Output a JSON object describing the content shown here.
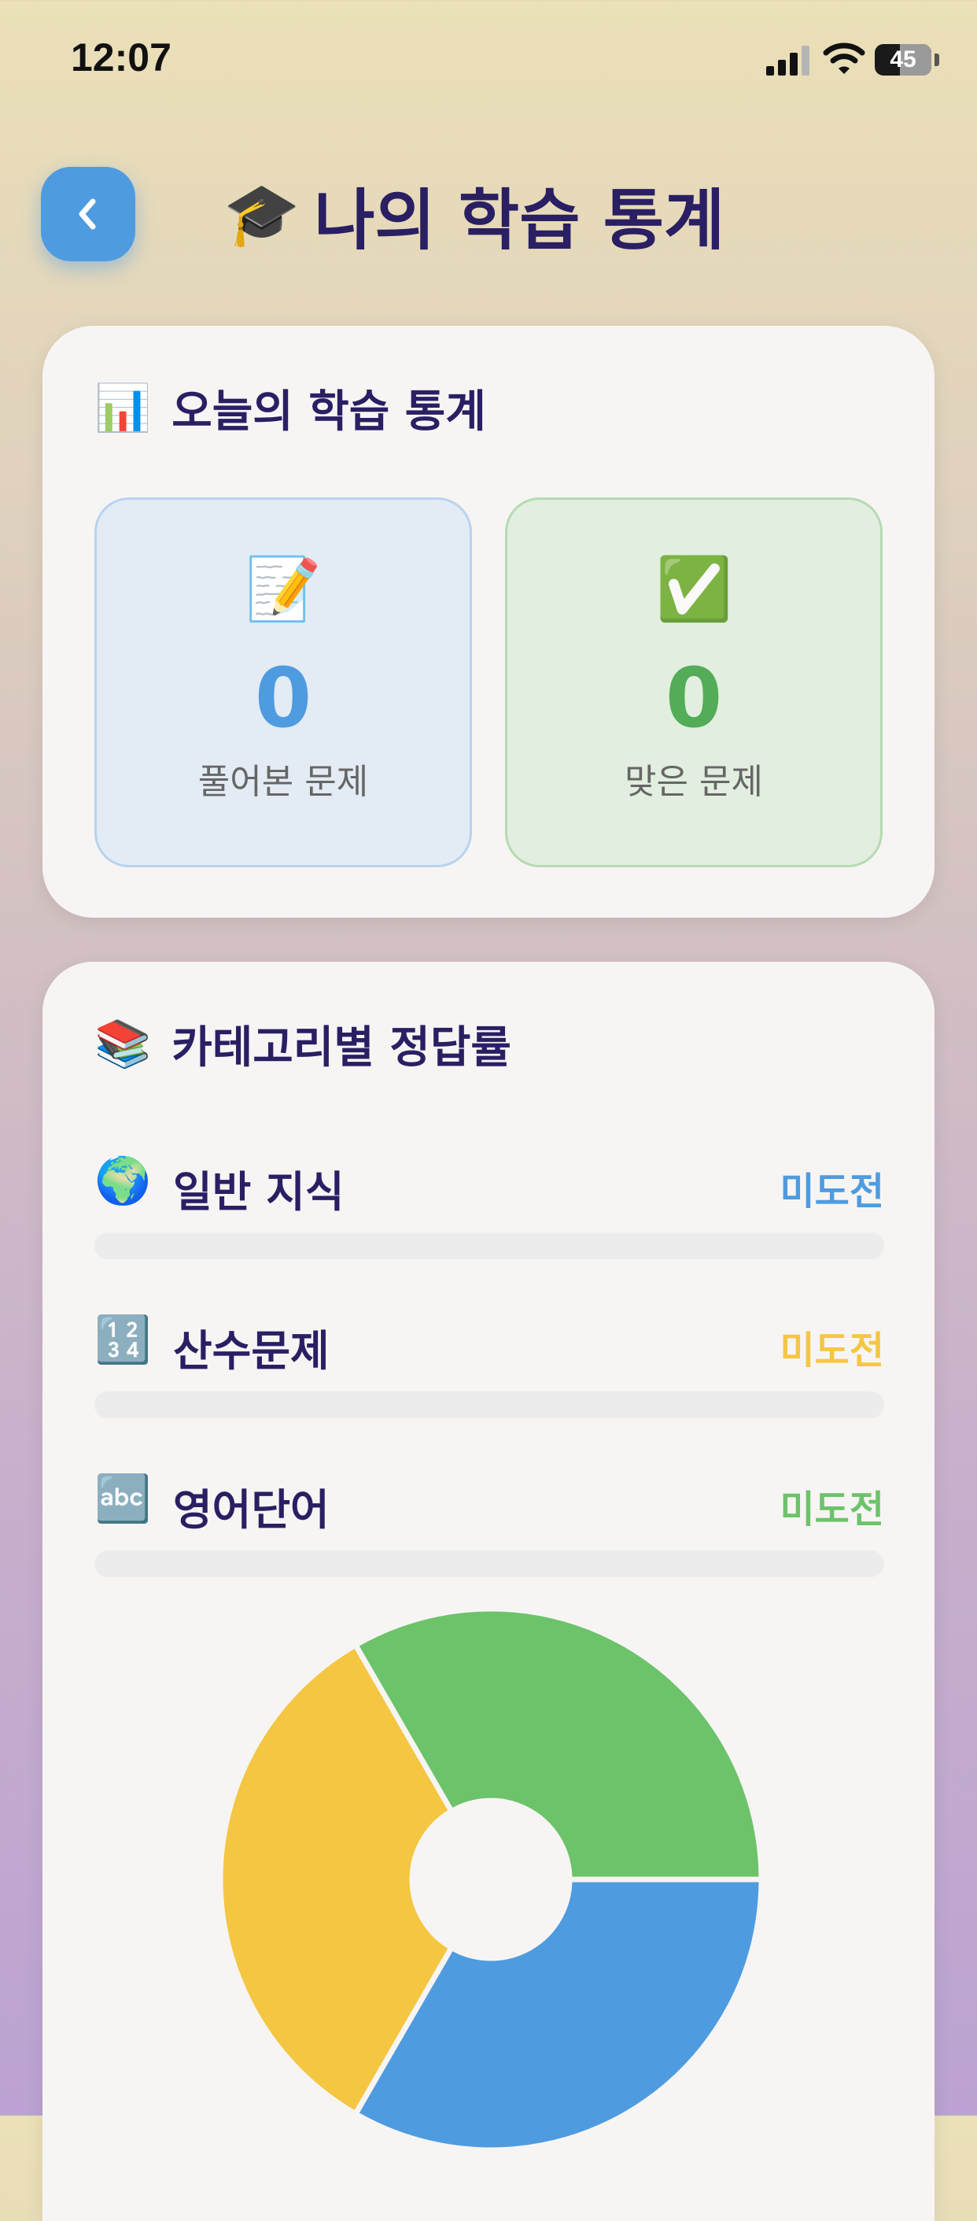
{
  "status_bar": {
    "time": "12:07",
    "battery": "45"
  },
  "header": {
    "title_emoji": "🎓",
    "title": "나의 학습 통계"
  },
  "today": {
    "emoji": "📊",
    "title": "오늘의 학습 통계",
    "solved": {
      "emoji": "📝",
      "value": "0",
      "label": "풀어본 문제"
    },
    "correct": {
      "emoji": "✅",
      "value": "0",
      "label": "맞은 문제"
    }
  },
  "categories": {
    "emoji": "📚",
    "title": "카테고리별 정답률",
    "items": [
      {
        "emoji": "🌍",
        "name": "일반 지식",
        "status": "미도전",
        "progress": 0
      },
      {
        "emoji": "🔢",
        "name": "산수문제",
        "status": "미도전",
        "progress": 0
      },
      {
        "emoji": "🔤",
        "name": "영어단어",
        "status": "미도전",
        "progress": 0
      }
    ]
  },
  "colors": {
    "blue": "#4f9be0",
    "yellow": "#f4c642",
    "green": "#6cc36a",
    "title": "#2a1f63"
  },
  "chart_data": {
    "type": "pie",
    "categories": [
      "일반 지식",
      "산수문제",
      "영어단어"
    ],
    "values": [
      1,
      1,
      1
    ],
    "colors": [
      "#4f9be0",
      "#f4c642",
      "#6cc36a"
    ],
    "donut": true
  }
}
